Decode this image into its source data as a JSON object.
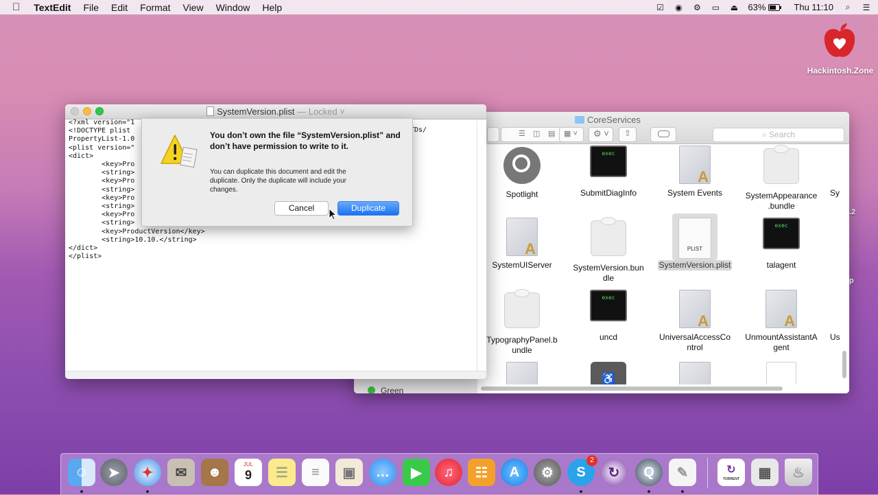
{
  "menubar": {
    "app_name": "TextEdit",
    "menus": [
      "File",
      "Edit",
      "Format",
      "View",
      "Window",
      "Help"
    ],
    "battery": "63%",
    "clock": "Thu 11:10"
  },
  "desktop": {
    "hackintosh_label": "Hackintosh.Zone",
    "edge_fragments": [
      ".2",
      "p"
    ]
  },
  "finder": {
    "title": "CoreServices",
    "search_placeholder": "Search",
    "sidebar_tag_green": "Green",
    "items": [
      {
        "label": "Spotlight",
        "icon": "spotlight-icon"
      },
      {
        "label": "SubmitDiagInfo",
        "icon": "exec-icon",
        "icon_text": "exec"
      },
      {
        "label": "System Events",
        "icon": "app-icon"
      },
      {
        "label": "SystemAppearance\n.bundle",
        "icon": "bundle-icon"
      },
      {
        "label": "Sy",
        "icon": "partial"
      },
      {
        "label": "SystemUIServer",
        "icon": "app-icon"
      },
      {
        "label": "SystemVersion.bun\ndle",
        "icon": "bundle-icon"
      },
      {
        "label": "SystemVersion.plist",
        "icon": "plist-icon",
        "icon_text": "PLIST",
        "selected": true
      },
      {
        "label": "talagent",
        "icon": "exec-icon",
        "icon_text": "exec"
      },
      {
        "label": "TypographyPanel.b\nundle",
        "icon": "bundle-icon"
      },
      {
        "label": "uncd",
        "icon": "exec-icon",
        "icon_text": "exec"
      },
      {
        "label": "UniversalAccessCo\nntrol",
        "icon": "app-icon"
      },
      {
        "label": "UnmountAssistantA\ngent",
        "icon": "app-icon"
      },
      {
        "label": "Us",
        "icon": "partial"
      }
    ]
  },
  "textedit": {
    "filename": "SystemVersion.plist",
    "status": "— Locked",
    "content": "<?xml version=\"1\n<!DOCTYPE plist\nPropertyList-1.0\n<plist version=\"\n<dict>\n        <key>Pro\n        <string>\n        <key>Pro\n        <string>\n        <key>Pro\n        <string>\n        <key>Pro\n        <string>\n        <key>ProductVersion</key>\n        <string>10.10.</string>\n</dict>\n</plist>",
    "line_fragment": "TDs/"
  },
  "alert": {
    "title": "You don’t own the file “SystemVersion.plist” and don’t have permission to write to it.",
    "message": "You can duplicate this document and edit the duplicate. Only the duplicate will include your changes.",
    "cancel_label": "Cancel",
    "duplicate_label": "Duplicate"
  },
  "dock": {
    "calendar_month": "JUL",
    "calendar_day": "9",
    "skype_badge": "2",
    "torrent_label": "TORRENT"
  },
  "colors": {
    "accent_blue": "#1773f2",
    "exec_green": "#4cd964",
    "close_red": "#fc605c",
    "minimize_yellow": "#fdbc40",
    "zoom_green": "#34c84a"
  }
}
